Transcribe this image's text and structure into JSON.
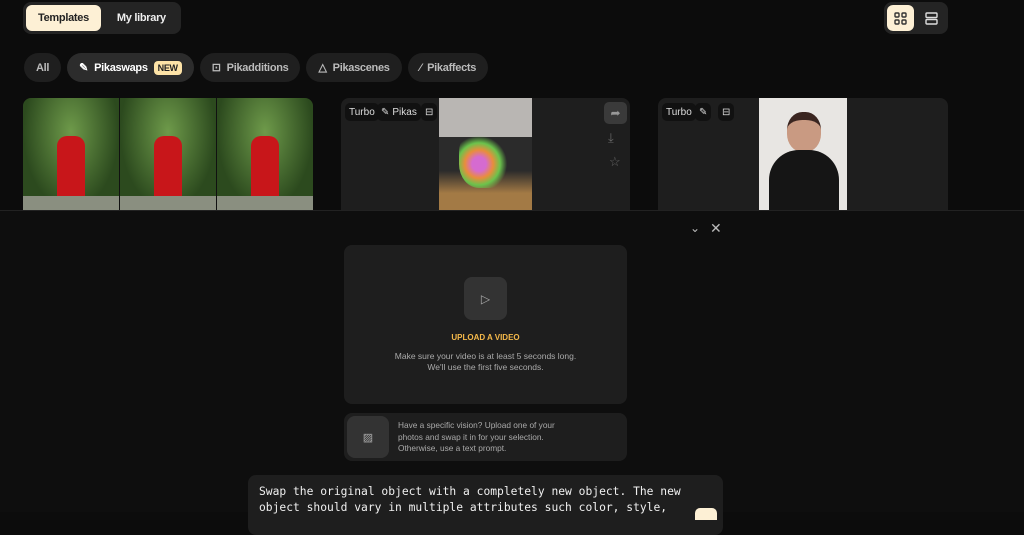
{
  "tabs": [
    {
      "label": "Templates",
      "active": true
    },
    {
      "label": "My library",
      "active": false
    }
  ],
  "view_toggle": [
    "grid-view-icon",
    "list-view-icon"
  ],
  "filters": [
    {
      "label": "All"
    },
    {
      "label": "Pikaswaps",
      "badge": "NEW",
      "icon": "swap-wand-icon"
    },
    {
      "label": "Pikadditions",
      "icon": "add-frame-icon"
    },
    {
      "label": "Pikascenes",
      "icon": "shapes-icon"
    },
    {
      "label": "Pikaffects",
      "icon": "magic-wand-icon"
    }
  ],
  "cards": [
    {
      "tags": []
    },
    {
      "tags": [
        "Turbo",
        "Pikas"
      ]
    },
    {
      "tags": [
        "Turbo"
      ]
    }
  ],
  "upload": {
    "title": "UPLOAD A VIDEO",
    "line1": "Make sure your video is at least 5 seconds long.",
    "line2": "We'll use the first five seconds."
  },
  "hint": "Have a specific vision? Upload one of your photos and swap it in for your selection. Otherwise, use a text prompt.",
  "prompt": "Swap the original object with a completely new object. The new object should vary in multiple attributes such color, style,",
  "colors": {
    "accent": "#fdf0d5",
    "upload_title": "#f5b94a"
  }
}
